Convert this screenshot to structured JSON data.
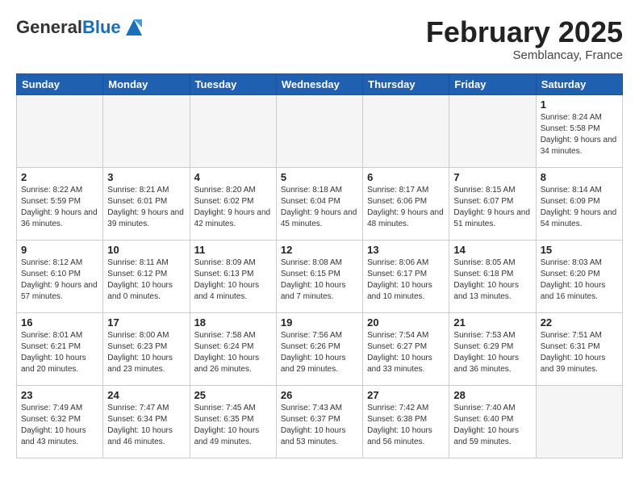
{
  "header": {
    "logo": {
      "general": "General",
      "blue": "Blue"
    },
    "title": "February 2025",
    "subtitle": "Semblancay, France"
  },
  "days_of_week": [
    "Sunday",
    "Monday",
    "Tuesday",
    "Wednesday",
    "Thursday",
    "Friday",
    "Saturday"
  ],
  "weeks": [
    [
      {
        "day": "",
        "info": ""
      },
      {
        "day": "",
        "info": ""
      },
      {
        "day": "",
        "info": ""
      },
      {
        "day": "",
        "info": ""
      },
      {
        "day": "",
        "info": ""
      },
      {
        "day": "",
        "info": ""
      },
      {
        "day": "1",
        "info": "Sunrise: 8:24 AM\nSunset: 5:58 PM\nDaylight: 9 hours and 34 minutes."
      }
    ],
    [
      {
        "day": "2",
        "info": "Sunrise: 8:22 AM\nSunset: 5:59 PM\nDaylight: 9 hours and 36 minutes."
      },
      {
        "day": "3",
        "info": "Sunrise: 8:21 AM\nSunset: 6:01 PM\nDaylight: 9 hours and 39 minutes."
      },
      {
        "day": "4",
        "info": "Sunrise: 8:20 AM\nSunset: 6:02 PM\nDaylight: 9 hours and 42 minutes."
      },
      {
        "day": "5",
        "info": "Sunrise: 8:18 AM\nSunset: 6:04 PM\nDaylight: 9 hours and 45 minutes."
      },
      {
        "day": "6",
        "info": "Sunrise: 8:17 AM\nSunset: 6:06 PM\nDaylight: 9 hours and 48 minutes."
      },
      {
        "day": "7",
        "info": "Sunrise: 8:15 AM\nSunset: 6:07 PM\nDaylight: 9 hours and 51 minutes."
      },
      {
        "day": "8",
        "info": "Sunrise: 8:14 AM\nSunset: 6:09 PM\nDaylight: 9 hours and 54 minutes."
      }
    ],
    [
      {
        "day": "9",
        "info": "Sunrise: 8:12 AM\nSunset: 6:10 PM\nDaylight: 9 hours and 57 minutes."
      },
      {
        "day": "10",
        "info": "Sunrise: 8:11 AM\nSunset: 6:12 PM\nDaylight: 10 hours and 0 minutes."
      },
      {
        "day": "11",
        "info": "Sunrise: 8:09 AM\nSunset: 6:13 PM\nDaylight: 10 hours and 4 minutes."
      },
      {
        "day": "12",
        "info": "Sunrise: 8:08 AM\nSunset: 6:15 PM\nDaylight: 10 hours and 7 minutes."
      },
      {
        "day": "13",
        "info": "Sunrise: 8:06 AM\nSunset: 6:17 PM\nDaylight: 10 hours and 10 minutes."
      },
      {
        "day": "14",
        "info": "Sunrise: 8:05 AM\nSunset: 6:18 PM\nDaylight: 10 hours and 13 minutes."
      },
      {
        "day": "15",
        "info": "Sunrise: 8:03 AM\nSunset: 6:20 PM\nDaylight: 10 hours and 16 minutes."
      }
    ],
    [
      {
        "day": "16",
        "info": "Sunrise: 8:01 AM\nSunset: 6:21 PM\nDaylight: 10 hours and 20 minutes."
      },
      {
        "day": "17",
        "info": "Sunrise: 8:00 AM\nSunset: 6:23 PM\nDaylight: 10 hours and 23 minutes."
      },
      {
        "day": "18",
        "info": "Sunrise: 7:58 AM\nSunset: 6:24 PM\nDaylight: 10 hours and 26 minutes."
      },
      {
        "day": "19",
        "info": "Sunrise: 7:56 AM\nSunset: 6:26 PM\nDaylight: 10 hours and 29 minutes."
      },
      {
        "day": "20",
        "info": "Sunrise: 7:54 AM\nSunset: 6:27 PM\nDaylight: 10 hours and 33 minutes."
      },
      {
        "day": "21",
        "info": "Sunrise: 7:53 AM\nSunset: 6:29 PM\nDaylight: 10 hours and 36 minutes."
      },
      {
        "day": "22",
        "info": "Sunrise: 7:51 AM\nSunset: 6:31 PM\nDaylight: 10 hours and 39 minutes."
      }
    ],
    [
      {
        "day": "23",
        "info": "Sunrise: 7:49 AM\nSunset: 6:32 PM\nDaylight: 10 hours and 43 minutes."
      },
      {
        "day": "24",
        "info": "Sunrise: 7:47 AM\nSunset: 6:34 PM\nDaylight: 10 hours and 46 minutes."
      },
      {
        "day": "25",
        "info": "Sunrise: 7:45 AM\nSunset: 6:35 PM\nDaylight: 10 hours and 49 minutes."
      },
      {
        "day": "26",
        "info": "Sunrise: 7:43 AM\nSunset: 6:37 PM\nDaylight: 10 hours and 53 minutes."
      },
      {
        "day": "27",
        "info": "Sunrise: 7:42 AM\nSunset: 6:38 PM\nDaylight: 10 hours and 56 minutes."
      },
      {
        "day": "28",
        "info": "Sunrise: 7:40 AM\nSunset: 6:40 PM\nDaylight: 10 hours and 59 minutes."
      },
      {
        "day": "",
        "info": ""
      }
    ]
  ]
}
